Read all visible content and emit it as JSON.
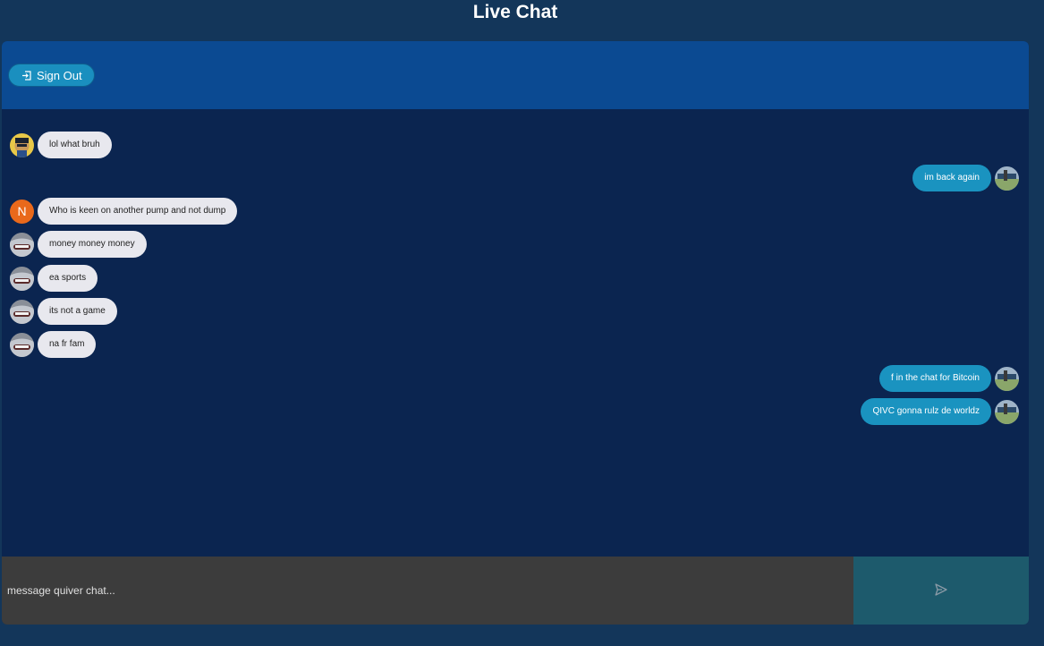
{
  "page": {
    "title": "Live Chat"
  },
  "header": {
    "signout_label": "Sign Out",
    "signout_icon": "sign-out-icon"
  },
  "messages": [
    {
      "side": "received",
      "text": "lol what bruh",
      "avatar": "photo-avatar-cartoon"
    },
    {
      "side": "sent",
      "text": "im back again",
      "avatar": "photo-avatar-field"
    },
    {
      "side": "received",
      "text": "Who is keen on another pump and not dump",
      "avatar_letter": "N"
    },
    {
      "side": "received",
      "text": "money money money",
      "avatar": "photo-avatar-grin"
    },
    {
      "side": "received",
      "text": "ea sports",
      "avatar": "photo-avatar-grin"
    },
    {
      "side": "received",
      "text": "its not a game",
      "avatar": "photo-avatar-grin"
    },
    {
      "side": "received",
      "text": "na fr fam",
      "avatar": "photo-avatar-grin"
    },
    {
      "side": "sent",
      "text": "f in the chat for Bitcoin",
      "avatar": "photo-avatar-field"
    },
    {
      "side": "sent",
      "text": "QIVC gonna rulz de worldz",
      "avatar": "photo-avatar-field"
    }
  ],
  "composer": {
    "placeholder": "message quiver chat...",
    "value": "",
    "send_icon": "send-icon"
  },
  "colors": {
    "background": "#13365a",
    "header": "#0b4a92",
    "messages_area": "#0b2550",
    "sent_bubble": "#1a93c0",
    "received_bubble": "#e8e8ee",
    "input": "#3c3c3c",
    "send_button": "#1d5a6c"
  }
}
